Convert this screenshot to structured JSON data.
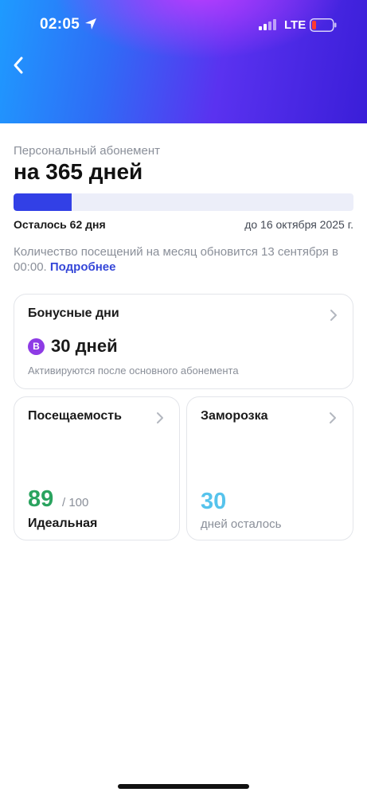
{
  "status_bar": {
    "time": "02:05",
    "network": "LTE",
    "icons": [
      "location-arrow-icon",
      "signal-icon",
      "battery-low-icon"
    ]
  },
  "header": {
    "back_icon": "chevron-left-icon",
    "colors": {
      "gradient_start": "#1e9bff",
      "gradient_mid": "#5a32f0",
      "gradient_end": "#3a1ed8",
      "glow": "#be3cff"
    }
  },
  "subscription": {
    "type": "Персональный абонемент",
    "title": "на 365 дней",
    "progress_fraction": 0.17,
    "remaining": "Осталось 62 дня",
    "until": "до 16 октября 2025 г.",
    "info_text": "Количество посещений на месяц обновится 13 сентября в 00:00.",
    "info_link": "Подробнее",
    "colors": {
      "progress_fill": "#3240e6",
      "progress_track": "#eceef9",
      "link": "#3547d8"
    }
  },
  "bonus": {
    "title": "Бонусные дни",
    "badge": "B",
    "value": "30 дней",
    "note": "Активируются после основного абонемента",
    "colors": {
      "badge": "#8e3be5"
    }
  },
  "attendance": {
    "title": "Посещаемость",
    "score": "89",
    "max": "/ 100",
    "label": "Идеальная",
    "colors": {
      "score": "#2aa35f"
    }
  },
  "freeze": {
    "title": "Заморозка",
    "value": "30",
    "label": "дней осталось",
    "colors": {
      "value": "#56c3ec"
    }
  }
}
